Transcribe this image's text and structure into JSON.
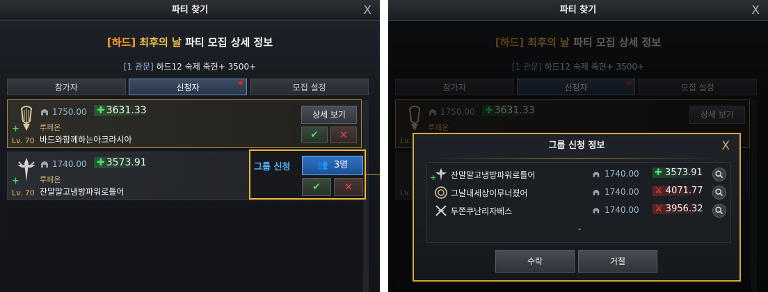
{
  "window_title": "파티 찾기",
  "close_glyph": "X",
  "heading": {
    "difficulty": "[하드]",
    "raid": "최후의 날",
    "rest": "파티 모집 상세 정보"
  },
  "subheading": {
    "gate": "[1 관문]",
    "info": "하드12 숙제 죽현+ 3500+"
  },
  "tabs": [
    {
      "label": "참가자"
    },
    {
      "label": "신청자",
      "notification": true
    },
    {
      "label": "모집 설정"
    }
  ],
  "applicants": [
    {
      "item_level": "1750.00",
      "combat_power": "3631.33",
      "class": "루페온",
      "level": "Lv. 70",
      "name": "바드와함께하는아크라시아",
      "detail_label": "상세 보기",
      "class_icon": "bard-harp-icon"
    },
    {
      "item_level": "1740.00",
      "combat_power": "3573.91",
      "class": "루페온",
      "level": "Lv. 70",
      "name": "잔말말고냉방파워로틀어",
      "class_icon": "paladin-sword-icon"
    }
  ],
  "group_apply": {
    "label": "그룹 신청",
    "count": "3명"
  },
  "modal": {
    "title": "그룹 신청 정보",
    "members": [
      {
        "name": "잔말말고냉방파워로틀어",
        "item_level": "1740.00",
        "power": "3573.91",
        "trend": "up",
        "icon": "paladin-sword-icon",
        "leader": true
      },
      {
        "name": "그날내세상이무너졌어",
        "item_level": "1740.00",
        "power": "4071.77",
        "trend": "down",
        "icon": "medallion-icon",
        "leader": false
      },
      {
        "name": "두쫀쿠난리자베스",
        "item_level": "1740.00",
        "power": "3956.32",
        "trend": "down",
        "icon": "crossed-blades-icon",
        "leader": false
      }
    ],
    "empty_slot": "-",
    "accept_label": "수락",
    "reject_label": "거절"
  },
  "colors": {
    "accent_gold": "#d7a83a",
    "difficulty_orange": "#ff9f2a",
    "raid_yellow": "#f0c14a",
    "power_green": "#4fe06a",
    "power_red": "#ff5a3c",
    "group_blue": "#4fb4ff"
  }
}
